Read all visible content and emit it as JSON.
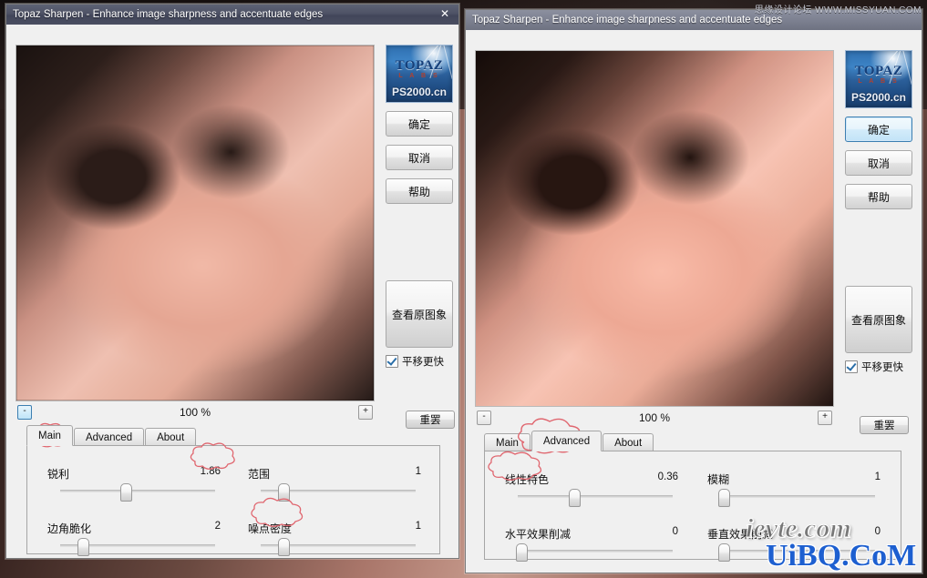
{
  "watermarks": {
    "top_right": "思缘设计论坛 WWW.MISSYUAN.COM",
    "bottom_gray": "ievte.com",
    "bottom_blue": "UiBQ.CoM"
  },
  "left_window": {
    "title": "Topaz Sharpen - Enhance image sharpness and accentuate edges",
    "close_label": "✕",
    "logo": {
      "brand": "TOPAZ",
      "sub": "L A B S",
      "site": "PS2000.cn"
    },
    "buttons": {
      "ok": "确定",
      "cancel": "取消",
      "help": "帮助"
    },
    "preview_button": "查看原图象",
    "checkbox": {
      "label": "平移更快",
      "checked": true
    },
    "zoom": {
      "minus": "-",
      "plus": "+",
      "level": "100 %"
    },
    "reset_label": "重罢",
    "tabs": [
      {
        "label": "Main",
        "active": true,
        "annotated": true
      },
      {
        "label": "Advanced",
        "active": false,
        "annotated": false
      },
      {
        "label": "About",
        "active": false,
        "annotated": false
      }
    ],
    "sliders": [
      {
        "label": "锐利",
        "value": "1.86",
        "pos_pct": 42,
        "annotate_value": true,
        "annotate_label": false
      },
      {
        "label": "范围",
        "value": "1",
        "pos_pct": 14,
        "annotate_value": false,
        "annotate_label": false
      },
      {
        "label": "边角脆化",
        "value": "2",
        "pos_pct": 14,
        "annotate_value": false,
        "annotate_label": false
      },
      {
        "label": "噪点密度",
        "value": "1",
        "pos_pct": 14,
        "annotate_value": false,
        "annotate_label": true
      }
    ]
  },
  "right_window": {
    "title": "Topaz Sharpen - Enhance image sharpness and accentuate edges",
    "logo": {
      "brand": "TOPAZ",
      "sub": "L A B S",
      "site": "PS2000.cn"
    },
    "buttons": {
      "ok": "确定",
      "cancel": "取消",
      "help": "帮助"
    },
    "preview_button": "查看原图象",
    "checkbox": {
      "label": "平移更快",
      "checked": true
    },
    "zoom": {
      "minus": "-",
      "plus": "+",
      "level": "100 %"
    },
    "reset_label": "重罢",
    "tabs": [
      {
        "label": "Main",
        "active": false,
        "annotated": false
      },
      {
        "label": "Advanced",
        "active": true,
        "annotated": true
      },
      {
        "label": "About",
        "active": false,
        "annotated": false
      }
    ],
    "sliders": [
      {
        "label": "线性特色",
        "value": "0.36",
        "pos_pct": 36,
        "annotate_value": false,
        "annotate_label": true
      },
      {
        "label": "模糊",
        "value": "1",
        "pos_pct": 2,
        "annotate_value": false,
        "annotate_label": false
      },
      {
        "label": "水平效果削减",
        "value": "0",
        "pos_pct": 2,
        "annotate_value": false,
        "annotate_label": false
      },
      {
        "label": "垂直效果削减",
        "value": "0",
        "pos_pct": 2,
        "annotate_value": false,
        "annotate_label": false
      }
    ]
  },
  "colors": {
    "window_bg": "#f0f0f0",
    "titlebar": "#4e5265",
    "annotation_red": "#e06a72",
    "focus_blue": "#3c7fb1",
    "logo_blue": "#2f6fb0"
  }
}
